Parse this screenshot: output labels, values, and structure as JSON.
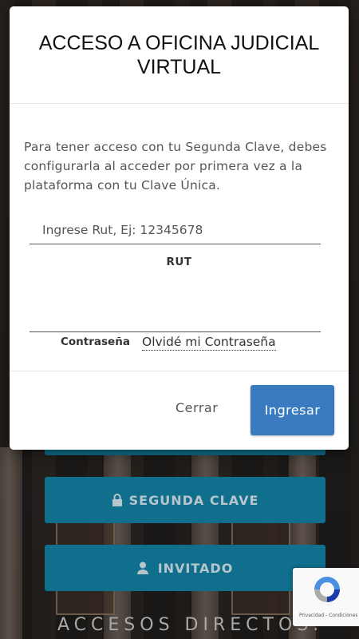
{
  "modal": {
    "title": "ACCESO A OFICINA JUDICIAL VIRTUAL",
    "intro": "Para tener acceso con tu Segunda Clave, debes configurarla al acceder por primera vez a la plataforma con tu Clave Única.",
    "rut_placeholder": "Ingrese Rut, Ej: 12345678",
    "rut_label": "RUT",
    "password_label": "Contraseña",
    "forgot_password_link": "Olvidé mi Contraseña",
    "close_button": "Cerrar",
    "login_button": "Ingresar"
  },
  "background": {
    "buttons": [
      {
        "label": "SEGUNDA CLAVE",
        "icon": "lock-icon"
      },
      {
        "label": "INVITADO",
        "icon": "user-icon"
      }
    ],
    "accesos_title": "ACCESOS DIRECTOS.",
    "recaptcha_text": "Privacidad - Condiciones",
    "button_color": "#0f6f8c"
  },
  "colors": {
    "primary": "#3a7bc0"
  }
}
